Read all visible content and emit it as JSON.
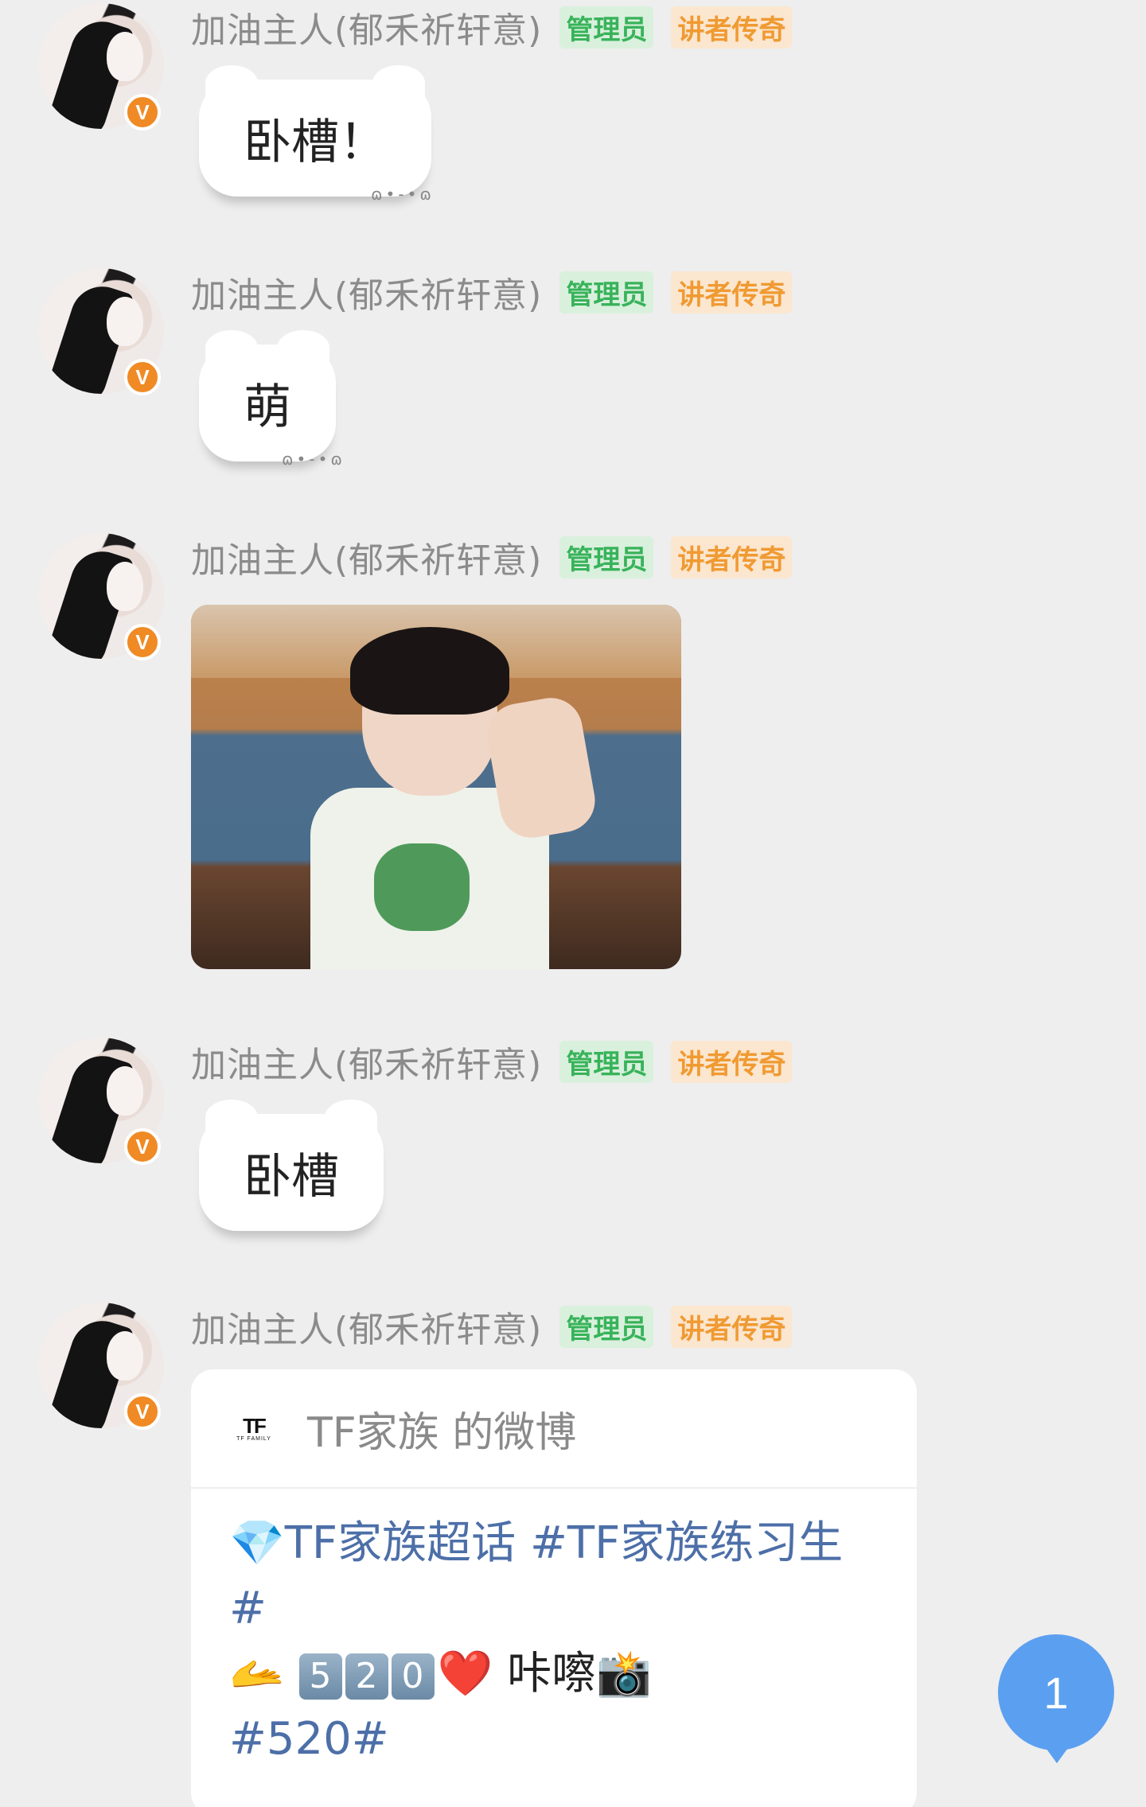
{
  "user": {
    "name": "加油主人(郁禾祈轩意)",
    "tag_admin": "管理员",
    "tag_talker": "讲者传奇",
    "badge": "V"
  },
  "messages": [
    {
      "type": "text",
      "text": "卧槽！"
    },
    {
      "type": "text",
      "text": "萌"
    },
    {
      "type": "image"
    },
    {
      "type": "text",
      "text": "卧槽"
    },
    {
      "type": "card"
    }
  ],
  "card": {
    "logo_mark": "TF",
    "logo_sub": "TF FAMILY",
    "title": "TF家族 的微博",
    "line1": "💎TF家族超话 #TF家族练习生",
    "line2": "#",
    "line3_prefix": "🫴 ",
    "keycaps": [
      "5",
      "2",
      "0"
    ],
    "line3_heart": "❤️",
    "line3_suffix": " 咔嚓📸",
    "line4": "#520#"
  },
  "unread_count": "1",
  "colors": {
    "background": "#eeeeee",
    "admin_tag": "#38b35a",
    "talker_tag": "#f09a32",
    "link": "#4d6fa8",
    "unread_bubble": "#5b9ff0",
    "vip_badge": "#f08a24"
  },
  "icons": [
    "avatar",
    "vip-badge-icon",
    "tf-family-logo",
    "unread-indicator"
  ]
}
